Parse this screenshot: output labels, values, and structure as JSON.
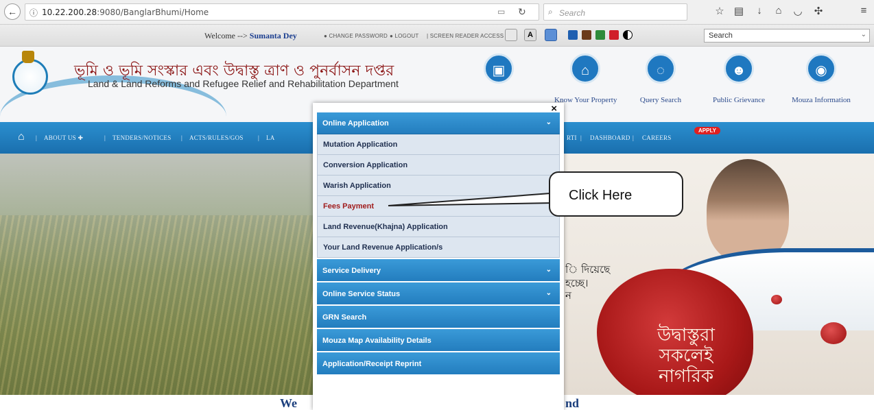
{
  "browser": {
    "url_host": "10.22.200.28",
    "url_rest": ":9080/BanglarBhumi/Home",
    "search_placeholder": "Search",
    "icons": [
      "back-arrow-icon",
      "info-icon",
      "reader-view-icon",
      "reload-icon",
      "search-icon",
      "bookmark-star-icon",
      "reading-list-icon",
      "download-icon",
      "home-icon",
      "pocket-icon",
      "extension-icon",
      "menu-icon"
    ]
  },
  "topbar": {
    "welcome_prefix": "Welcome -->",
    "user_name": "Sumanta Dey",
    "change_password": "CHANGE PASSWORD",
    "logout": "LOGOUT",
    "screen_reader": "SCREEN READER ACCESS",
    "language_select": "Search",
    "colors": [
      "#1f5fb0",
      "#6b3a1a",
      "#2e8b3a",
      "#d01f2a"
    ]
  },
  "header": {
    "title_bengali": "ভূমি ও ভূমি সংস্কার এবং উদ্বাস্তু ত্রাণ ও পুনর্বাসন দপ্তর",
    "title_english": "Land & Land Reforms and Refugee Relief and Rehabilitation Department",
    "quick_links": [
      {
        "label": "Know Your Property",
        "icon": "home-icon"
      },
      {
        "label": "Query Search",
        "icon": "chat-icon"
      },
      {
        "label": "Public Grievance",
        "icon": "users-icon"
      },
      {
        "label": "Mouza Information",
        "icon": "globe-icon"
      }
    ]
  },
  "nav": {
    "about": "ABOUT US",
    "tenders": "TENDERS/NOTICES",
    "acts": "ACTS/RULES/GOS",
    "la": "LA",
    "rti": "RTI",
    "dashboard": "DASHBOARD",
    "careers": "CAREERS",
    "apply_badge": "APPLY"
  },
  "banner": {
    "line1": "ি দিয়েছে",
    "line2": "হচ্ছে।",
    "line3": "ন",
    "seal_line1": "উদ্বাস্তুরা",
    "seal_line2": "সকলেই",
    "seal_line3": "নাগরিক",
    "footer_left": "We",
    "footer_right": "nd"
  },
  "menu": {
    "close": "×",
    "online_application": "Online Application",
    "items": [
      "Mutation Application",
      "Conversion Application",
      "Warish Application",
      "Fees Payment",
      "Land Revenue(Khajna) Application",
      "Your Land Revenue Application/s"
    ],
    "service_delivery": "Service Delivery",
    "online_service_status": "Online Service Status",
    "grn_search": "GRN Search",
    "mouza_map": "Mouza Map Availability Details",
    "receipt_reprint": "Application/Receipt Reprint"
  },
  "callout": {
    "text": "Click Here"
  }
}
